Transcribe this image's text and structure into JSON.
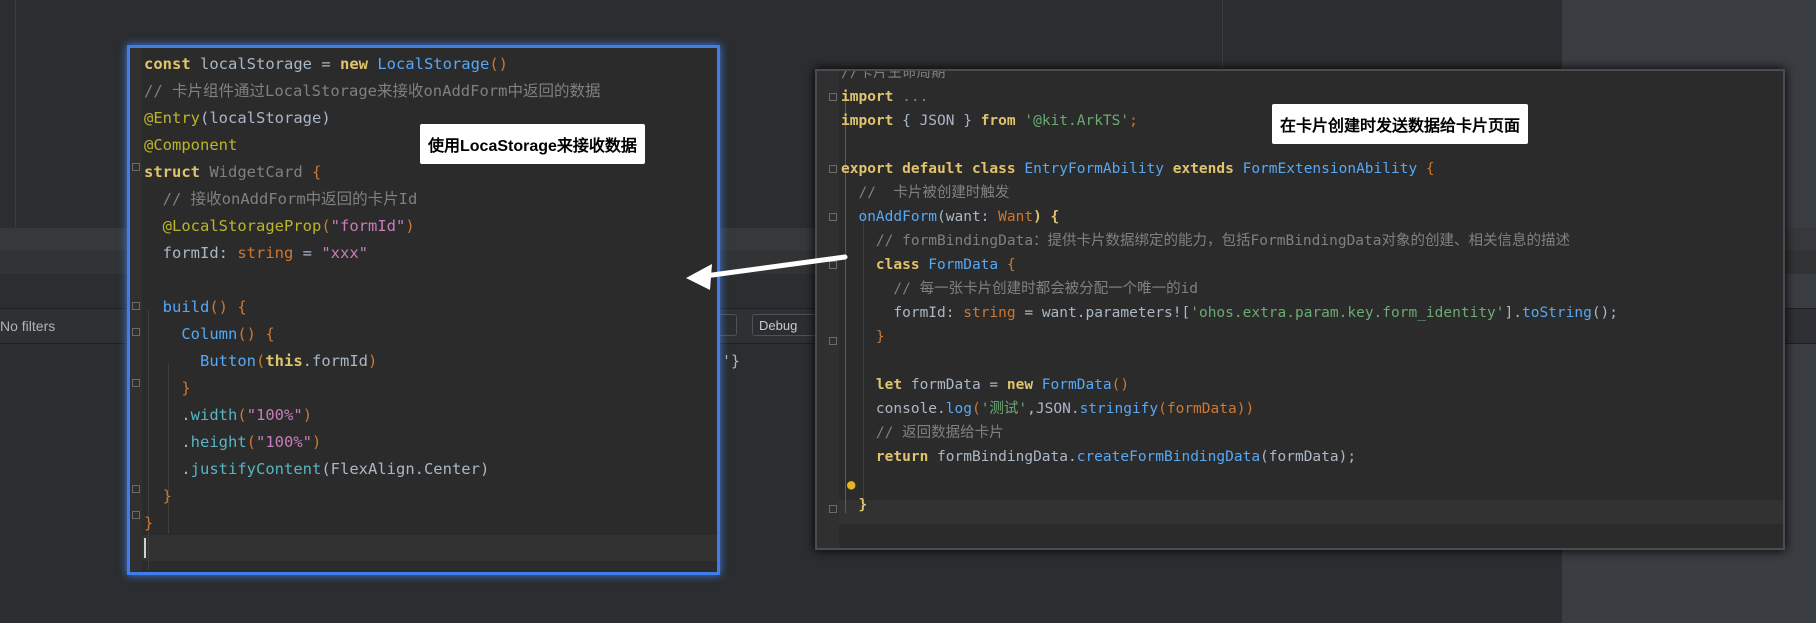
{
  "background": {
    "filter_label": "No filters",
    "debug_label": "Debug",
    "stray_text": "'}"
  },
  "left_code": {
    "l1_kw": "const",
    "l1_id": " localStorage = ",
    "l1_new": "new",
    "l1_cls": " LocalStorage",
    "l1_paren": "()",
    "l2": "// 卡片组件通过LocalStorage来接收onAddForm中返回的数据",
    "l3_an": "@Entry",
    "l3_rest": "(localStorage)",
    "l4": "@Component",
    "l5_kw": "struct",
    "l5_cls": " WidgetCard",
    "l5_rest": " {",
    "l6": "  // 接收onAddForm中返回的卡片Id",
    "l7_an": "  @LocalStorageProp",
    "l7_p1": "(",
    "l7_st": "\"formId\"",
    "l7_p2": ")",
    "l8_id": "  formId",
    "l8_colon": ": ",
    "l8_ty": "string",
    "l8_eq": " = ",
    "l8_st": "\"xxx\"",
    "l10_fn": "  build",
    "l10_rest": "() {",
    "l11_fn": "    Column",
    "l11_rest": "() {",
    "l12_fn": "      Button",
    "l12_p": "(",
    "l12_kw": "this",
    "l12_rest": ".formId",
    "l12_p2": ")",
    "l13": "    }",
    "l14_dot": "    .",
    "l14_fn": "width",
    "l14_p": "(",
    "l14_st": "\"100%\"",
    "l14_p2": ")",
    "l15_dot": "    .",
    "l15_fn": "height",
    "l15_p": "(",
    "l15_st": "\"100%\"",
    "l15_p2": ")",
    "l16_dot": "    .",
    "l16_fn": "justifyContent",
    "l16_rest": "(FlexAlign.Center)",
    "l17": "  }",
    "l18": "}"
  },
  "right_code": {
    "r0": "//卡片生命周期",
    "r1_kw": "import",
    "r1_rest": " ...",
    "r2_kw": "import",
    "r2_b": " { JSON } ",
    "r2_from": "from",
    "r2_st": " '@kit.ArkTS'",
    "r2_semi": ";",
    "r4_kw": "export default class",
    "r4_cls": " EntryFormAbility",
    "r4_ext": " extends",
    "r4_cls2": " FormExtensionAbility",
    "r4_rest": " {",
    "r5": "  //  卡片被创建时触发",
    "r6_fn": "  onAddForm",
    "r6_p": "(want: ",
    "r6_ty": "Want",
    "r6_rest": ") {",
    "r7": "    // formBindingData：提供卡片数据绑定的能力，包括FormBindingData对象的创建、相关信息的描述",
    "r8_kw": "    class",
    "r8_cls": " FormData",
    "r8_rest": " {",
    "r9": "      // 每一张卡片创建时都会被分配一个唯一的id",
    "r10_id": "      formId",
    "r10_c": ": ",
    "r10_ty": "string",
    "r10_eq": " = want.parameters![",
    "r10_st": "'ohos.extra.param.key.form_identity'",
    "r10_rb": "].",
    "r10_fn": "toString",
    "r10_end": "();",
    "r11": "    }",
    "r13_kw": "    let",
    "r13_id": " formData = ",
    "r13_new": "new",
    "r13_cls": " FormData",
    "r13_end": "()",
    "r14_id": "    console.",
    "r14_fn": "log",
    "r14_p": "(",
    "r14_st": "'测试'",
    "r14_mid": ",JSON.",
    "r14_fn2": "stringify",
    "r14_end": "(formData))",
    "r15": "    // 返回数据给卡片",
    "r16_kw": "    return",
    "r16_id": " formBindingData.",
    "r16_fn": "createFormBindingData",
    "r16_end": "(formData);",
    "r18": "  }"
  },
  "labels": {
    "left": "使用LocaStorage来接收数据",
    "right": "在卡片创建时发送数据给卡片页面"
  }
}
